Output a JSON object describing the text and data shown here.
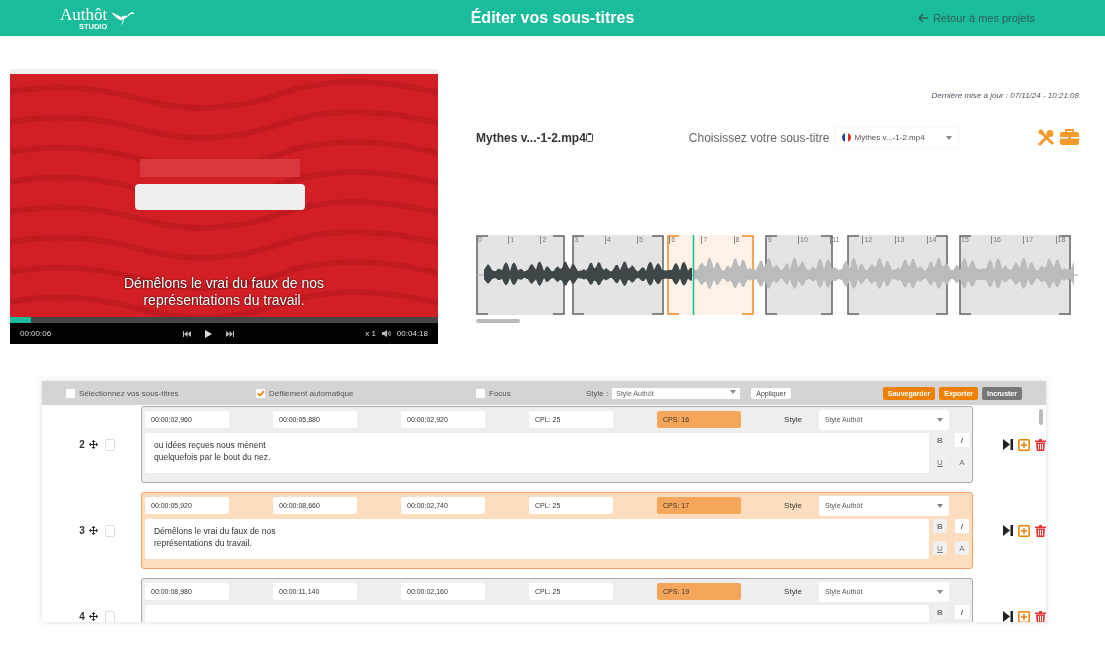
{
  "header": {
    "logo": "Authôt",
    "logo_sub": "STUDIO",
    "title": "Éditer vos sous-titres",
    "back_link": "Retour à mes projets"
  },
  "player": {
    "subtitle": "Démêlons le vrai du faux de nos représentations du travail.",
    "level": 0.05,
    "current_time": "00:00:06",
    "speed": "x 1",
    "duration": "00:04:18"
  },
  "last_update": "Dernière mise à jour : 07/11/24 - 10:21:08",
  "file_name": "Mythes v...-1-2.mp4",
  "subtitle_picker": {
    "label": "Choisissez votre sous-titre",
    "value": "Mythes v...-1-2.mp4"
  },
  "waveform": {
    "ticks": [
      "0",
      "1",
      "2",
      "3",
      "4",
      "5",
      "6",
      "7",
      "8",
      "9",
      "10",
      "11",
      "12",
      "13",
      "14",
      "15",
      "16",
      "17",
      "18"
    ],
    "level": 0.36,
    "segments": [
      {
        "selected": false
      },
      {
        "selected": false
      },
      {
        "selected": true
      },
      {
        "selected": false
      },
      {
        "selected": false
      },
      {
        "selected": false
      }
    ]
  },
  "toolbar": {
    "checks": [
      {
        "label": "Sélectionnez vos sous-titres",
        "checked": false
      },
      {
        "label": "Défilement automatique",
        "checked": true
      },
      {
        "label": "Focus",
        "checked": false
      }
    ],
    "style_label": "Style :",
    "style_value": "Style Authôt",
    "apply": "Appliquer",
    "buttons": [
      {
        "label": "Sauvegarder",
        "kind": "primary"
      },
      {
        "label": "Exporter",
        "kind": "primary"
      },
      {
        "label": "Incruster",
        "kind": "secondary"
      }
    ]
  },
  "subtitles": [
    {
      "number": "2",
      "selected": false,
      "checked": false,
      "start": "00:00:02,960",
      "end": "00:00:05,880",
      "duration": "00:00:02,920",
      "cpl": "CPL: 25",
      "cps": "CPS: 16",
      "style_label": "Style",
      "style": "Style Authôt",
      "text": "ou idées reçues nous mènent\nquelquefois par le bout du nez.",
      "format_buttons": [
        "B",
        "I",
        "U",
        "A"
      ]
    },
    {
      "number": "3",
      "selected": true,
      "checked": false,
      "start": "00:00:05,920",
      "end": "00:00:08,660",
      "duration": "00:00:02,740",
      "cpl": "CPL: 25",
      "cps": "CPS: 17",
      "style_label": "Style",
      "style": "Style Authôt",
      "text": "Démêlons le vrai du faux de nos\nreprésentations du travail.",
      "format_buttons": [
        "B",
        "I",
        "U",
        "A"
      ]
    },
    {
      "number": "4",
      "selected": false,
      "checked": false,
      "start": "00:00:08,980",
      "end": "00:00:11,140",
      "duration": "00:00:02,160",
      "cpl": "CPL: 25",
      "cps": "CPS: 19",
      "style_label": "Style",
      "style": "Style Authôt",
      "format_buttons": [
        "B",
        "I"
      ]
    }
  ]
}
